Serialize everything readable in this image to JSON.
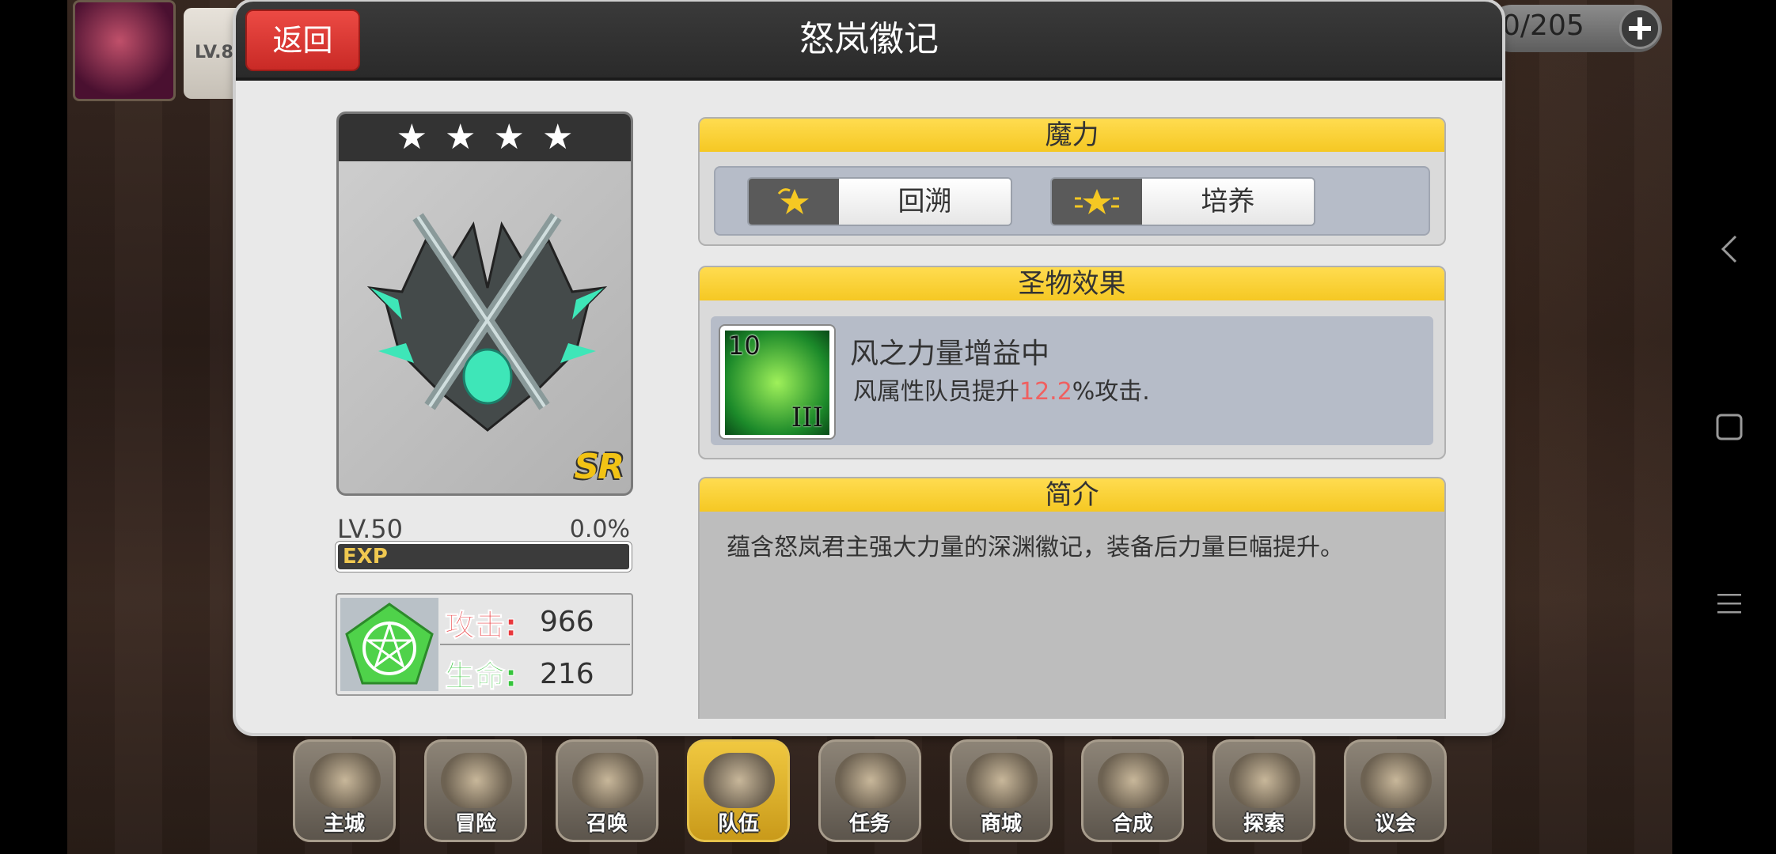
{
  "player": {
    "level_text": "LV.8"
  },
  "resource": {
    "count": "0/205"
  },
  "dialog": {
    "title": "怒岚徽记",
    "back_label": "返回"
  },
  "item": {
    "stars": [
      "★",
      "★",
      "★",
      "★"
    ],
    "rarity": "SR",
    "level": "LV.50",
    "exp_percent": "0.0%",
    "exp_label": "EXP",
    "stats": [
      {
        "name": "攻击:",
        "value": "966",
        "color": "#e8373b"
      },
      {
        "name": "生命:",
        "value": "216",
        "color": "#36c43c"
      }
    ]
  },
  "magic": {
    "header": "魔力",
    "buttons": [
      {
        "label": "回溯",
        "icon": "star-rewind-icon"
      },
      {
        "label": "培养",
        "icon": "star-upgrade-icon"
      }
    ]
  },
  "effect": {
    "header": "圣物效果",
    "skill_level": "10",
    "skill_rank": "III",
    "name": "风之力量增益中",
    "desc_prefix": "风属性队员提升",
    "desc_value": "12.2",
    "desc_suffix": "%攻击."
  },
  "description": {
    "header": "简介",
    "text": "蕴含怒岚君主强大力量的深渊徽记，装备后力量巨幅提升。"
  },
  "bottom_menu": [
    {
      "label": "主城",
      "active": false
    },
    {
      "label": "冒险",
      "active": false
    },
    {
      "label": "召唤",
      "active": false
    },
    {
      "label": "队伍",
      "active": true
    },
    {
      "label": "任务",
      "active": false
    },
    {
      "label": "商城",
      "active": false
    },
    {
      "label": "合成",
      "active": false
    },
    {
      "label": "探索",
      "active": false
    },
    {
      "label": "议会",
      "active": false
    }
  ],
  "colors": {
    "accent_yellow": "#f5c823",
    "back_button_red": "#e03a35",
    "highlight_value": "#f06060"
  }
}
